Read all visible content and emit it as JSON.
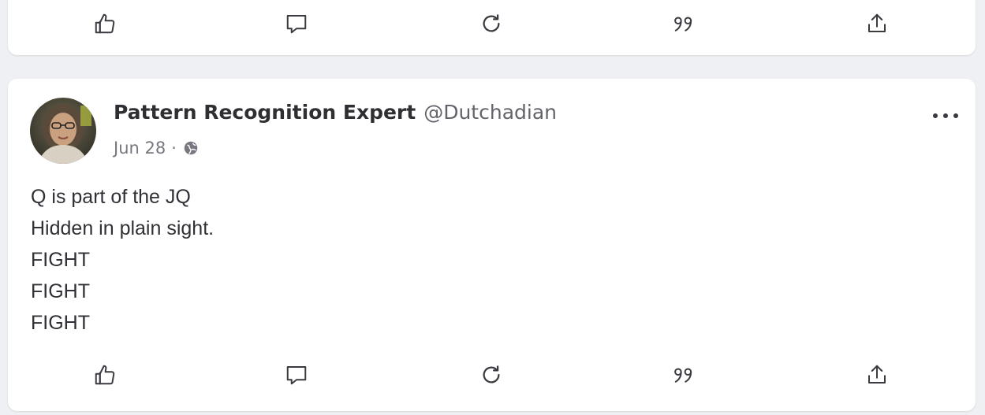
{
  "previous_post": {
    "actions": [
      {
        "name": "like-button",
        "icon": "thumbs-up-icon"
      },
      {
        "name": "comment-button",
        "icon": "comment-bubble-icon"
      },
      {
        "name": "repost-button",
        "icon": "repost-arrow-icon"
      },
      {
        "name": "quote-button",
        "icon": "quote-marks-icon"
      },
      {
        "name": "share-button",
        "icon": "share-upload-icon"
      }
    ]
  },
  "post": {
    "author": {
      "display_name": "Pattern Recognition Expert",
      "handle": "@Dutchadian",
      "avatar": "user-avatar-photo"
    },
    "date": "Jun 28",
    "separator": "·",
    "visibility_icon": "public-globe-icon",
    "more_icon": "more-options-icon",
    "content_lines": [
      "Q is part of the JQ",
      "Hidden in plain sight.",
      "FIGHT",
      "FIGHT",
      "FIGHT"
    ],
    "actions": [
      {
        "name": "like-button",
        "icon": "thumbs-up-icon"
      },
      {
        "name": "comment-button",
        "icon": "comment-bubble-icon"
      },
      {
        "name": "repost-button",
        "icon": "repost-arrow-icon"
      },
      {
        "name": "quote-button",
        "icon": "quote-marks-icon"
      },
      {
        "name": "share-button",
        "icon": "share-upload-icon"
      }
    ]
  },
  "colors": {
    "background": "#eef0f3",
    "card": "#ffffff",
    "text_primary": "#2f2f33",
    "text_secondary": "#63636b",
    "icon": "#3a3a40"
  }
}
